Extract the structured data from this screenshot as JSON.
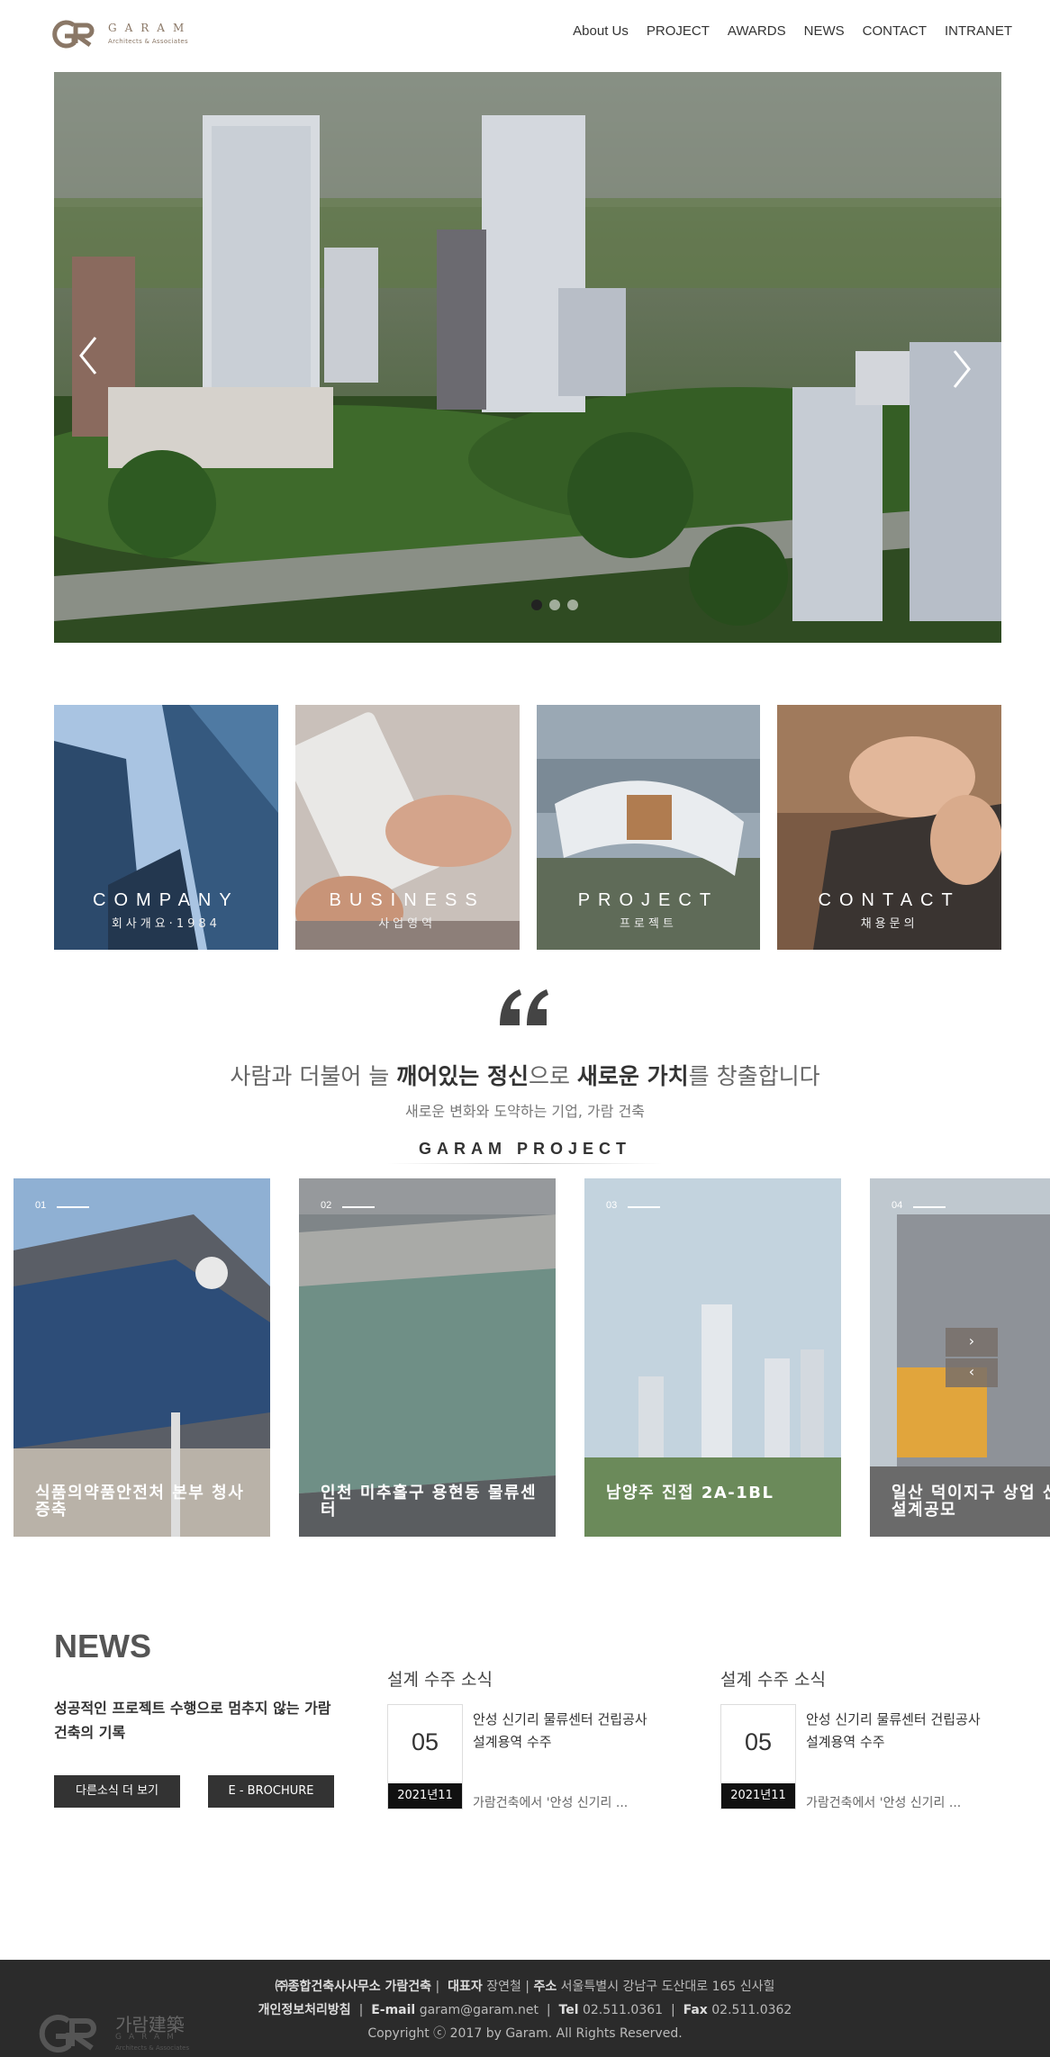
{
  "header": {
    "logo_word": "GARAM",
    "logo_sub": "Architects & Associates",
    "nav": [
      "About Us",
      "PROJECT",
      "AWARDS",
      "NEWS",
      "CONTACT",
      "INTRANET"
    ]
  },
  "hero": {
    "slide_count": 3,
    "active_slide": 1
  },
  "tiles": [
    {
      "title": "COMPANY",
      "sub": "회사개요·1984"
    },
    {
      "title": "BUSINESS",
      "sub": "사업영역"
    },
    {
      "title": "PROJECT",
      "sub": "프로젝트"
    },
    {
      "title": "CONTACT",
      "sub": "채용문의"
    }
  ],
  "tagline": {
    "p1": "사람과 더불어 늘 ",
    "b1": "깨어있는 정신",
    "p2": "으로 ",
    "b2": "새로운 가치",
    "p3": "를 창출합니다"
  },
  "subtagline": "새로운 변화와 도약하는 기업, 가람 건축",
  "section_title": "GARAM PROJECT",
  "projects": [
    {
      "num": "01",
      "title": "식품의약품안전처 본부 청사 증축"
    },
    {
      "num": "02",
      "title": "인천 미추홀구 용현동 물류센터"
    },
    {
      "num": "03",
      "title": "남양주 진접 2A-1BL"
    },
    {
      "num": "04",
      "title": "일산 덕이지구 상업 신축공사 설계공모"
    }
  ],
  "project_nav": {
    "next": "›",
    "prev": "‹"
  },
  "news": {
    "heading": "NEWS",
    "desc": "성공적인 프로젝트 수행으로 멈추지 않는 가람 건축의 기록",
    "btn_more": "다른소식 더 보기",
    "btn_brochure": "E - BROCHURE",
    "items": [
      {
        "category": "설계 수주 소식",
        "day": "05",
        "ym": "2021년11",
        "title": "안성 신기리 물류센터 건립공사 설계용역 수주",
        "excerpt": "가람건축에서 '안성 신기리 ..."
      },
      {
        "category": "설계 수주 소식",
        "day": "05",
        "ym": "2021년11",
        "title": "안성 신기리 물류센터 건립공사 설계용역 수주",
        "excerpt": "가람건축에서 '안성 신기리 ..."
      }
    ]
  },
  "footer": {
    "company": "㈜종합건축사사무소 가람건축",
    "rep_label": "대표자",
    "rep": "장연철",
    "addr_label": "주소",
    "addr": "서울특별시 강남구 도산대로 165 신사힐",
    "privacy": "개인정보처리방침",
    "email_label": "E-mail",
    "email": "garam@garam.net",
    "tel_label": "Tel",
    "tel": "02.511.0361",
    "fax_label": "Fax",
    "fax": "02.511.0362",
    "copyright": "Copyright ⓒ 2017 by Garam. All Rights Reserved.",
    "logo_kr": "가람建築",
    "logo_en": "GARAM",
    "logo_sub": "Architects & Associates"
  },
  "colors": {
    "brand": "#8a7766",
    "dark": "#333333",
    "footer": "#2b2b2b"
  },
  "icons": [
    "garam-logo-icon",
    "chevron-left-icon",
    "chevron-right-icon",
    "quote-icon"
  ]
}
